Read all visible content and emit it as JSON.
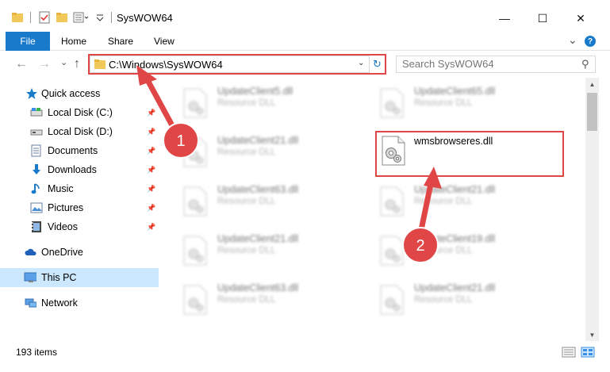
{
  "window": {
    "title": "SysWOW64",
    "minimize": "—",
    "maximize": "☐",
    "close": "✕"
  },
  "ribbon": {
    "file": "File",
    "tabs": [
      "Home",
      "Share",
      "View"
    ],
    "expand": "⌄",
    "help": "?"
  },
  "nav": {
    "back": "←",
    "forward": "→",
    "recent": "⌄",
    "up": "↑",
    "address": "C:\\Windows\\SysWOW64",
    "address_dropdown": "⌄",
    "refresh": "↻",
    "search_placeholder": "Search SysWOW64",
    "search_icon": "⚲"
  },
  "sidebar": {
    "items": [
      {
        "label": "Quick access",
        "icon": "star-icon"
      },
      {
        "label": "Local Disk (C:)",
        "icon": "drive-icon",
        "pinned": true
      },
      {
        "label": "Local Disk (D:)",
        "icon": "drive-icon",
        "pinned": true
      },
      {
        "label": "Documents",
        "icon": "documents-icon",
        "pinned": true
      },
      {
        "label": "Downloads",
        "icon": "downloads-icon",
        "pinned": true
      },
      {
        "label": "Music",
        "icon": "music-icon",
        "pinned": true
      },
      {
        "label": "Pictures",
        "icon": "pictures-icon",
        "pinned": true
      },
      {
        "label": "Videos",
        "icon": "videos-icon",
        "pinned": true
      },
      {
        "label": "OneDrive",
        "icon": "cloud-icon"
      },
      {
        "label": "This PC",
        "icon": "computer-icon",
        "selected": true
      },
      {
        "label": "Network",
        "icon": "network-icon"
      }
    ]
  },
  "files": [
    {
      "name": "UpdateClient5.dll",
      "type": "Resource DLL",
      "blurred": true
    },
    {
      "name": "UpdateClient65.dll",
      "type": "Resource DLL",
      "blurred": true
    },
    {
      "name": "UpdateClient21.dll",
      "type": "Resource DLL",
      "blurred": true
    },
    {
      "name": "wmsbrowseres.dll",
      "type": "",
      "blurred": false
    },
    {
      "name": "UpdateClient63.dll",
      "type": "Resource DLL",
      "blurred": true
    },
    {
      "name": "UpdateClient21.dll",
      "type": "Resource DLL",
      "blurred": true
    },
    {
      "name": "UpdateClient21.dll",
      "type": "Resource DLL",
      "blurred": true
    },
    {
      "name": "UpdateClient19.dll",
      "type": "Resource DLL",
      "blurred": true
    },
    {
      "name": "UpdateClient63.dll",
      "type": "Resource DLL",
      "blurred": true
    },
    {
      "name": "UpdateClient21.dll",
      "type": "Resource DLL",
      "blurred": true
    }
  ],
  "status": {
    "items_count": "193 items"
  },
  "annotations": {
    "step1": "1",
    "step2": "2",
    "color": "#e04646"
  },
  "colors": {
    "accent": "#1979ca",
    "selection": "#cce8ff",
    "highlight": "#e04646"
  }
}
